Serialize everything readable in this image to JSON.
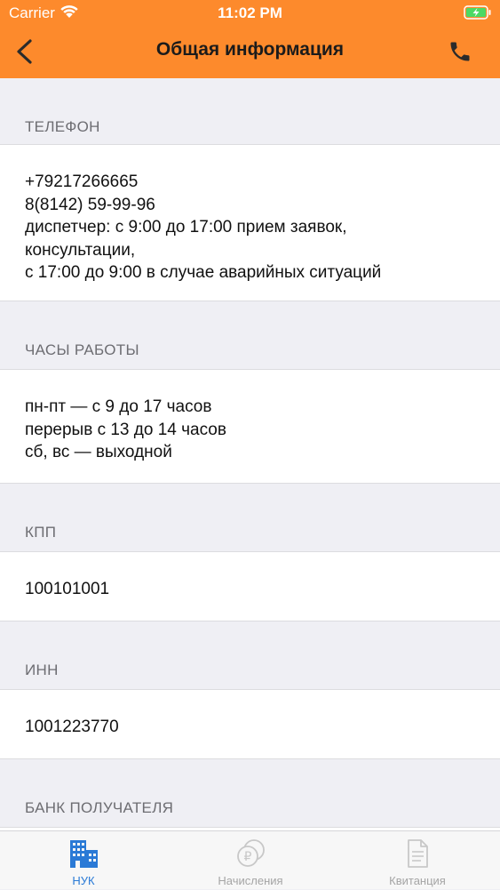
{
  "status_bar": {
    "carrier": "Carrier",
    "time": "11:02 PM"
  },
  "nav": {
    "title": "Общая информация"
  },
  "sections": [
    {
      "header": "ТЕЛЕФОН",
      "lines": [
        "+79217266665",
        "8(8142) 59-99-96",
        "диспетчер: с 9:00 до 17:00 прием заявок,",
        "консультации,",
        "с 17:00 до 9:00 в случае аварийных ситуаций"
      ]
    },
    {
      "header": "ЧАСЫ РАБОТЫ",
      "lines": [
        "пн-пт — с 9 до 17 часов",
        "перерыв с 13 до 14 часов",
        "сб, вс — выходной"
      ]
    },
    {
      "header": "КПП",
      "lines": [
        "100101001"
      ]
    },
    {
      "header": "ИНН",
      "lines": [
        "1001223770"
      ]
    },
    {
      "header": "БАНК ПОЛУЧАТЕЛЯ",
      "lines": []
    }
  ],
  "tabbar": {
    "items": [
      {
        "label": "НУК",
        "icon": "buildings-icon",
        "active": true
      },
      {
        "label": "Начисления",
        "icon": "ruble-coins-icon",
        "active": false
      },
      {
        "label": "Квитанция",
        "icon": "document-icon",
        "active": false
      }
    ]
  },
  "colors": {
    "header_bg": "#fd8a2c",
    "active_tab": "#2a7ad6",
    "inactive_tab": "#a5a5a5",
    "background": "#efeff4"
  }
}
